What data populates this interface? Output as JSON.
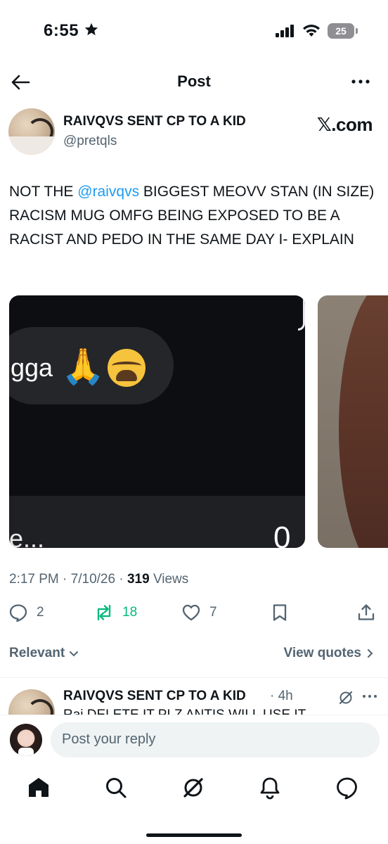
{
  "status_bar": {
    "time": "6:55",
    "battery": "25"
  },
  "nav": {
    "title": "Post"
  },
  "post": {
    "author": {
      "display_name": "RAIVQVS SENT CP TO A KID",
      "handle": "@pretqls"
    },
    "watermark": "𝕏.com",
    "text_before_mention": "NOT THE ",
    "mention": "@raivqvs",
    "text_after_mention": " BIGGEST MEOVV STAN (IN SIZE) RACISM MUG OMFG BEING EXPOSED TO BE A RACIST AND PEDO IN THE SAME DAY I- EXPLAIN",
    "media": [
      {
        "bubble_text": "gga",
        "input_text": "e...",
        "input_right": "0"
      }
    ],
    "time": "2:17 PM",
    "date": "7/10/26",
    "views_count": "319",
    "views_label": "Views",
    "separator": "·",
    "stats": {
      "replies": "2",
      "reposts": "18",
      "likes": "7"
    }
  },
  "sort": {
    "left_label": "Relevant",
    "right_label": "View quotes"
  },
  "reply": {
    "display_name": "RAIVQVS SENT CP TO A KID",
    "time": "· 4h",
    "text": "Rai DELETE IT PLZ ANTIS WILL USE IT"
  },
  "compose": {
    "placeholder": "Post your reply"
  },
  "colors": {
    "accent": "#1d9bf0",
    "repost_green": "#00ba7c",
    "secondary_text": "#536471"
  }
}
